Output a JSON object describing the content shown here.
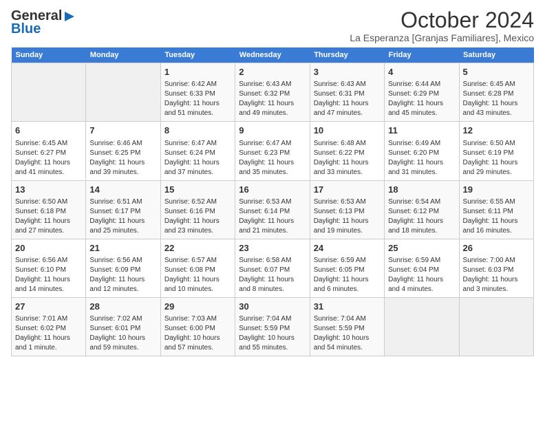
{
  "header": {
    "logo_line1": "General",
    "logo_line2": "Blue",
    "title": "October 2024",
    "subtitle": "La Esperanza [Granjas Familiares], Mexico"
  },
  "calendar": {
    "days_of_week": [
      "Sunday",
      "Monday",
      "Tuesday",
      "Wednesday",
      "Thursday",
      "Friday",
      "Saturday"
    ],
    "weeks": [
      [
        {
          "num": "",
          "content": ""
        },
        {
          "num": "",
          "content": ""
        },
        {
          "num": "1",
          "content": "Sunrise: 6:42 AM\nSunset: 6:33 PM\nDaylight: 11 hours and 51 minutes."
        },
        {
          "num": "2",
          "content": "Sunrise: 6:43 AM\nSunset: 6:32 PM\nDaylight: 11 hours and 49 minutes."
        },
        {
          "num": "3",
          "content": "Sunrise: 6:43 AM\nSunset: 6:31 PM\nDaylight: 11 hours and 47 minutes."
        },
        {
          "num": "4",
          "content": "Sunrise: 6:44 AM\nSunset: 6:29 PM\nDaylight: 11 hours and 45 minutes."
        },
        {
          "num": "5",
          "content": "Sunrise: 6:45 AM\nSunset: 6:28 PM\nDaylight: 11 hours and 43 minutes."
        }
      ],
      [
        {
          "num": "6",
          "content": "Sunrise: 6:45 AM\nSunset: 6:27 PM\nDaylight: 11 hours and 41 minutes."
        },
        {
          "num": "7",
          "content": "Sunrise: 6:46 AM\nSunset: 6:25 PM\nDaylight: 11 hours and 39 minutes."
        },
        {
          "num": "8",
          "content": "Sunrise: 6:47 AM\nSunset: 6:24 PM\nDaylight: 11 hours and 37 minutes."
        },
        {
          "num": "9",
          "content": "Sunrise: 6:47 AM\nSunset: 6:23 PM\nDaylight: 11 hours and 35 minutes."
        },
        {
          "num": "10",
          "content": "Sunrise: 6:48 AM\nSunset: 6:22 PM\nDaylight: 11 hours and 33 minutes."
        },
        {
          "num": "11",
          "content": "Sunrise: 6:49 AM\nSunset: 6:20 PM\nDaylight: 11 hours and 31 minutes."
        },
        {
          "num": "12",
          "content": "Sunrise: 6:50 AM\nSunset: 6:19 PM\nDaylight: 11 hours and 29 minutes."
        }
      ],
      [
        {
          "num": "13",
          "content": "Sunrise: 6:50 AM\nSunset: 6:18 PM\nDaylight: 11 hours and 27 minutes."
        },
        {
          "num": "14",
          "content": "Sunrise: 6:51 AM\nSunset: 6:17 PM\nDaylight: 11 hours and 25 minutes."
        },
        {
          "num": "15",
          "content": "Sunrise: 6:52 AM\nSunset: 6:16 PM\nDaylight: 11 hours and 23 minutes."
        },
        {
          "num": "16",
          "content": "Sunrise: 6:53 AM\nSunset: 6:14 PM\nDaylight: 11 hours and 21 minutes."
        },
        {
          "num": "17",
          "content": "Sunrise: 6:53 AM\nSunset: 6:13 PM\nDaylight: 11 hours and 19 minutes."
        },
        {
          "num": "18",
          "content": "Sunrise: 6:54 AM\nSunset: 6:12 PM\nDaylight: 11 hours and 18 minutes."
        },
        {
          "num": "19",
          "content": "Sunrise: 6:55 AM\nSunset: 6:11 PM\nDaylight: 11 hours and 16 minutes."
        }
      ],
      [
        {
          "num": "20",
          "content": "Sunrise: 6:56 AM\nSunset: 6:10 PM\nDaylight: 11 hours and 14 minutes."
        },
        {
          "num": "21",
          "content": "Sunrise: 6:56 AM\nSunset: 6:09 PM\nDaylight: 11 hours and 12 minutes."
        },
        {
          "num": "22",
          "content": "Sunrise: 6:57 AM\nSunset: 6:08 PM\nDaylight: 11 hours and 10 minutes."
        },
        {
          "num": "23",
          "content": "Sunrise: 6:58 AM\nSunset: 6:07 PM\nDaylight: 11 hours and 8 minutes."
        },
        {
          "num": "24",
          "content": "Sunrise: 6:59 AM\nSunset: 6:05 PM\nDaylight: 11 hours and 6 minutes."
        },
        {
          "num": "25",
          "content": "Sunrise: 6:59 AM\nSunset: 6:04 PM\nDaylight: 11 hours and 4 minutes."
        },
        {
          "num": "26",
          "content": "Sunrise: 7:00 AM\nSunset: 6:03 PM\nDaylight: 11 hours and 3 minutes."
        }
      ],
      [
        {
          "num": "27",
          "content": "Sunrise: 7:01 AM\nSunset: 6:02 PM\nDaylight: 11 hours and 1 minute."
        },
        {
          "num": "28",
          "content": "Sunrise: 7:02 AM\nSunset: 6:01 PM\nDaylight: 10 hours and 59 minutes."
        },
        {
          "num": "29",
          "content": "Sunrise: 7:03 AM\nSunset: 6:00 PM\nDaylight: 10 hours and 57 minutes."
        },
        {
          "num": "30",
          "content": "Sunrise: 7:04 AM\nSunset: 5:59 PM\nDaylight: 10 hours and 55 minutes."
        },
        {
          "num": "31",
          "content": "Sunrise: 7:04 AM\nSunset: 5:59 PM\nDaylight: 10 hours and 54 minutes."
        },
        {
          "num": "",
          "content": ""
        },
        {
          "num": "",
          "content": ""
        }
      ]
    ]
  }
}
